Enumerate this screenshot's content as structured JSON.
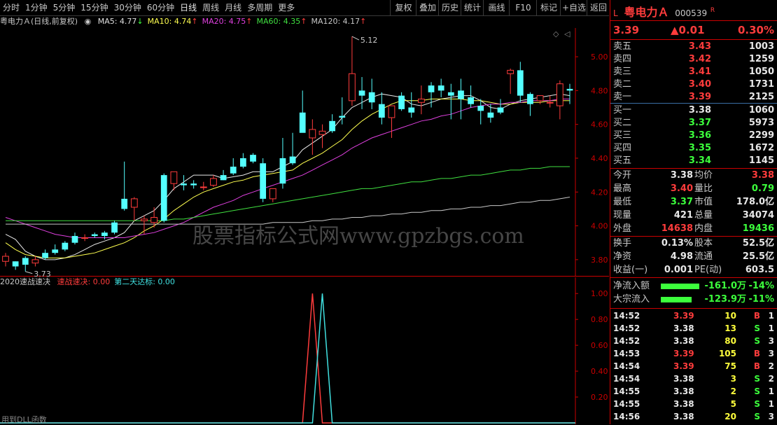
{
  "toolbar": {
    "left": [
      "分时",
      "1分钟",
      "5分钟",
      "15分钟",
      "30分钟",
      "60分钟",
      "日线",
      "周线",
      "月线",
      "多周期",
      "更多"
    ],
    "right": [
      "复权",
      "叠加",
      "历史",
      "统计",
      "画线",
      "F10",
      "标记",
      "+自选",
      "返回"
    ]
  },
  "ma_bar": {
    "title": "粤电力Ａ(日线,前复权)",
    "items": [
      {
        "label": "MA5: 4.77",
        "arrow": "↓",
        "color": "#e0e0e0"
      },
      {
        "label": "MA10: 4.74",
        "arrow": "↑",
        "color": "#ffff50"
      },
      {
        "label": "MA20: 4.75",
        "arrow": "↑",
        "color": "#e040e0"
      },
      {
        "label": "MA60: 4.35",
        "arrow": "↑",
        "color": "#40e040"
      },
      {
        "label": "MA120: 4.17",
        "arrow": "↑",
        "color": "#c8c8c8"
      }
    ]
  },
  "indicator_bar": {
    "name": "2020速战速决",
    "items": [
      {
        "label": "速战速决: 0.00",
        "color": "#ff3c3c"
      },
      {
        "label": "第二天达标: 0.00",
        "color": "#40e0e0"
      }
    ]
  },
  "watermark": "股票指标公式网www.gpzbgs.com",
  "footer_text": "用到DLL函数",
  "chart_data": [
    {
      "type": "candlestick",
      "ylim": [
        3.7,
        5.17
      ],
      "yticks": [
        "5.00",
        "4.80",
        "4.60",
        "4.40",
        "4.20",
        "4.00",
        "3.80"
      ],
      "annotations": [
        {
          "text": "5.12",
          "index": 35
        },
        {
          "text": "3.73",
          "index": 2
        }
      ],
      "candles": [
        [
          3.79,
          3.84,
          3.76,
          3.82
        ],
        [
          3.79,
          3.79,
          3.74,
          3.76
        ],
        [
          3.81,
          3.82,
          3.73,
          3.77
        ],
        [
          3.78,
          3.82,
          3.76,
          3.8
        ],
        [
          3.84,
          3.86,
          3.8,
          3.81
        ],
        [
          3.86,
          3.89,
          3.83,
          3.84
        ],
        [
          3.9,
          3.91,
          3.85,
          3.86
        ],
        [
          3.94,
          3.96,
          3.89,
          3.9
        ],
        [
          3.93,
          3.95,
          3.91,
          3.93
        ],
        [
          3.95,
          3.96,
          3.93,
          3.94
        ],
        [
          3.96,
          3.97,
          3.92,
          3.94
        ],
        [
          4.02,
          4.03,
          3.95,
          3.96
        ],
        [
          4.16,
          4.38,
          4.09,
          4.1
        ],
        [
          4.11,
          4.17,
          4.03,
          4.16
        ],
        [
          4.03,
          4.06,
          3.95,
          4.04
        ],
        [
          4.02,
          4.11,
          3.99,
          4.05
        ],
        [
          4.3,
          4.31,
          4.02,
          4.03
        ],
        [
          4.25,
          4.32,
          4.21,
          4.32
        ],
        [
          4.25,
          4.3,
          4.21,
          4.24
        ],
        [
          4.25,
          4.27,
          4.22,
          4.24
        ],
        [
          4.23,
          4.26,
          4.21,
          4.23
        ],
        [
          4.24,
          4.3,
          4.23,
          4.28
        ],
        [
          4.3,
          4.33,
          4.27,
          4.27
        ],
        [
          4.35,
          4.4,
          4.3,
          4.31
        ],
        [
          4.4,
          4.43,
          4.34,
          4.35
        ],
        [
          4.42,
          4.43,
          4.37,
          4.38
        ],
        [
          4.37,
          4.4,
          4.14,
          4.16
        ],
        [
          4.16,
          4.21,
          4.14,
          4.22
        ],
        [
          4.4,
          4.52,
          4.22,
          4.25
        ],
        [
          4.41,
          4.55,
          4.36,
          4.37
        ],
        [
          4.67,
          4.8,
          4.57,
          4.55
        ],
        [
          4.52,
          4.63,
          4.42,
          4.57
        ],
        [
          4.54,
          4.6,
          4.46,
          4.56
        ],
        [
          4.62,
          4.66,
          4.55,
          4.56
        ],
        [
          4.65,
          4.76,
          4.6,
          4.64
        ],
        [
          4.74,
          5.12,
          4.71,
          4.9
        ],
        [
          4.8,
          4.88,
          4.69,
          4.77
        ],
        [
          4.79,
          4.87,
          4.69,
          4.73
        ],
        [
          4.72,
          4.79,
          4.6,
          4.64
        ],
        [
          4.64,
          4.7,
          4.52,
          4.71
        ],
        [
          4.77,
          4.79,
          4.68,
          4.69
        ],
        [
          4.7,
          4.79,
          4.64,
          4.67
        ],
        [
          4.73,
          4.83,
          4.66,
          4.75
        ],
        [
          4.83,
          4.85,
          4.7,
          4.79
        ],
        [
          4.83,
          4.87,
          4.76,
          4.8
        ],
        [
          4.79,
          4.84,
          4.63,
          4.77
        ],
        [
          4.8,
          4.87,
          4.63,
          4.75
        ],
        [
          4.76,
          4.83,
          4.7,
          4.72
        ],
        [
          4.71,
          4.75,
          4.6,
          4.68
        ],
        [
          4.67,
          4.72,
          4.61,
          4.64
        ],
        [
          4.7,
          4.75,
          4.66,
          4.67
        ],
        [
          4.9,
          4.93,
          4.78,
          4.92
        ],
        [
          4.92,
          4.97,
          4.73,
          4.77
        ],
        [
          4.78,
          4.79,
          4.65,
          4.72
        ],
        [
          4.74,
          4.77,
          4.72,
          4.77
        ],
        [
          4.73,
          4.77,
          4.7,
          4.73
        ],
        [
          4.71,
          4.86,
          4.63,
          4.84
        ],
        [
          4.81,
          4.84,
          4.72,
          4.8
        ]
      ],
      "series": [
        {
          "name": "MA5",
          "color": "#e8e8e8"
        },
        {
          "name": "MA10",
          "color": "#ffff50"
        },
        {
          "name": "MA20",
          "color": "#e040e0"
        },
        {
          "name": "MA60",
          "color": "#40e040"
        },
        {
          "name": "MA120",
          "color": "#c8c8c8"
        }
      ],
      "ma_values": {
        "MA5": [
          3.95,
          3.92,
          3.85,
          3.82,
          3.8,
          3.8,
          3.81,
          3.83,
          3.86,
          3.89,
          3.91,
          3.93,
          3.96,
          4.03,
          4.06,
          4.09,
          4.15,
          4.22,
          4.26,
          4.3,
          4.3,
          4.3,
          4.28,
          4.29,
          4.3,
          4.32,
          4.32,
          4.32,
          4.35,
          4.38,
          4.45,
          4.49,
          4.53,
          4.57,
          4.64,
          4.7,
          4.73,
          4.76,
          4.78,
          4.77,
          4.76,
          4.72,
          4.71,
          4.73,
          4.75,
          4.76,
          4.77,
          4.77,
          4.74,
          4.7,
          4.69,
          4.72,
          4.74,
          4.75,
          4.76,
          4.77,
          4.78,
          4.77
        ],
        "MA10": [
          3.9,
          3.86,
          3.83,
          3.82,
          3.81,
          3.81,
          3.81,
          3.82,
          3.83,
          3.84,
          3.86,
          3.88,
          3.9,
          3.93,
          3.97,
          4.0,
          4.04,
          4.09,
          4.13,
          4.17,
          4.2,
          4.22,
          4.24,
          4.26,
          4.27,
          4.29,
          4.3,
          4.31,
          4.32,
          4.33,
          4.37,
          4.4,
          4.43,
          4.47,
          4.51,
          4.57,
          4.62,
          4.66,
          4.69,
          4.72,
          4.74,
          4.74,
          4.74,
          4.75,
          4.75,
          4.75,
          4.75,
          4.74,
          4.74,
          4.73,
          4.72,
          4.72,
          4.73,
          4.73,
          4.73,
          4.74,
          4.74,
          4.74
        ],
        "MA20": [
          4.05,
          4.03,
          4.01,
          3.99,
          3.97,
          3.95,
          3.94,
          3.93,
          3.93,
          3.93,
          3.93,
          3.93,
          3.93,
          3.94,
          3.95,
          3.96,
          3.98,
          4.0,
          4.02,
          4.05,
          4.08,
          4.11,
          4.13,
          4.15,
          4.18,
          4.2,
          4.22,
          4.24,
          4.26,
          4.28,
          4.3,
          4.33,
          4.36,
          4.39,
          4.42,
          4.46,
          4.49,
          4.52,
          4.54,
          4.56,
          4.58,
          4.6,
          4.62,
          4.63,
          4.65,
          4.66,
          4.68,
          4.7,
          4.71,
          4.72,
          4.72,
          4.73,
          4.73,
          4.74,
          4.74,
          4.74,
          4.75,
          4.75
        ],
        "MA60": [
          4.03,
          4.03,
          4.03,
          4.03,
          4.03,
          4.03,
          4.03,
          4.03,
          4.03,
          4.03,
          4.03,
          4.03,
          4.03,
          4.03,
          4.03,
          4.03,
          4.03,
          4.04,
          4.04,
          4.05,
          4.06,
          4.07,
          4.08,
          4.09,
          4.1,
          4.11,
          4.12,
          4.13,
          4.14,
          4.15,
          4.16,
          4.17,
          4.18,
          4.19,
          4.2,
          4.21,
          4.22,
          4.22,
          4.23,
          4.24,
          4.25,
          4.26,
          4.26,
          4.27,
          4.28,
          4.28,
          4.29,
          4.3,
          4.3,
          4.31,
          4.32,
          4.33,
          4.33,
          4.34,
          4.34,
          4.35,
          4.35,
          4.35
        ],
        "MA120": [
          4.01,
          4.01,
          4.01,
          4.01,
          4.01,
          4.01,
          4.01,
          4.01,
          4.01,
          4.01,
          4.01,
          4.01,
          4.01,
          4.01,
          4.01,
          4.01,
          4.01,
          4.01,
          4.01,
          4.01,
          4.01,
          4.01,
          4.01,
          4.01,
          4.01,
          4.01,
          4.01,
          4.02,
          4.02,
          4.02,
          4.02,
          4.03,
          4.03,
          4.04,
          4.04,
          4.05,
          4.05,
          4.06,
          4.06,
          4.07,
          4.07,
          4.08,
          4.08,
          4.09,
          4.09,
          4.1,
          4.1,
          4.11,
          4.11,
          4.12,
          4.12,
          4.13,
          4.14,
          4.14,
          4.15,
          4.15,
          4.16,
          4.17
        ]
      }
    },
    {
      "type": "line",
      "name": "2020速战速决",
      "ylim": [
        0,
        1.05
      ],
      "yticks": [
        "1.00",
        "0.80",
        "0.60",
        "0.40",
        "0.20"
      ],
      "series": [
        {
          "name": "速战速决",
          "color": "#ff3c3c",
          "spike_index": 31
        },
        {
          "name": "第二天达标",
          "color": "#40e0e0",
          "spike_index": 32
        }
      ]
    }
  ],
  "quote": {
    "market": "L",
    "name": "粤电力Ａ",
    "code": "000539",
    "flag": "R",
    "price": "3.39",
    "change": "▲0.01",
    "pct": "0.30%",
    "asks": [
      {
        "label": "卖五",
        "price": "3.43",
        "vol": "1003"
      },
      {
        "label": "卖四",
        "price": "3.42",
        "vol": "1259"
      },
      {
        "label": "卖三",
        "price": "3.41",
        "vol": "1050"
      },
      {
        "label": "卖二",
        "price": "3.40",
        "vol": "1731"
      },
      {
        "label": "卖一",
        "price": "3.39",
        "vol": "2125"
      }
    ],
    "bids": [
      {
        "label": "买一",
        "price": "3.38",
        "vol": "1060",
        "color": "wht"
      },
      {
        "label": "买二",
        "price": "3.37",
        "vol": "5973",
        "color": "grn"
      },
      {
        "label": "买三",
        "price": "3.36",
        "vol": "2299",
        "color": "grn"
      },
      {
        "label": "买四",
        "price": "3.35",
        "vol": "1672",
        "color": "grn"
      },
      {
        "label": "买五",
        "price": "3.34",
        "vol": "1145",
        "color": "grn"
      }
    ],
    "stats": [
      {
        "l1": "今开",
        "v1": "3.38",
        "c1": "wht",
        "l2": "均价",
        "v2": "3.38",
        "c2": "red"
      },
      {
        "l1": "最高",
        "v1": "3.40",
        "c1": "red",
        "l2": "量比",
        "v2": "0.79",
        "c2": "grn"
      },
      {
        "l1": "最低",
        "v1": "3.37",
        "c1": "grn",
        "l2": "市值",
        "v2": "178.0亿",
        "c2": "wht"
      },
      {
        "l1": "现量",
        "v1": "421",
        "c1": "wht",
        "l2": "总量",
        "v2": "34074",
        "c2": "wht"
      },
      {
        "l1": "外盘",
        "v1": "14638",
        "c1": "red",
        "l2": "内盘",
        "v2": "19436",
        "c2": "grn"
      }
    ],
    "fin": [
      {
        "l1": "换手",
        "v1": "0.13%",
        "c1": "wht",
        "l2": "股本",
        "v2": "52.5亿",
        "c2": "wht"
      },
      {
        "l1": "净资",
        "v1": "4.98",
        "c1": "wht",
        "l2": "流通",
        "v2": "25.5亿",
        "c2": "wht"
      },
      {
        "l1": "收益(一)",
        "v1": "0.001",
        "c1": "wht",
        "l2": "PE(动)",
        "v2": "603.5",
        "c2": "wht"
      }
    ],
    "flows": [
      {
        "label": "净流入额",
        "value": "-161.0万",
        "pct": "-14%",
        "bar": 1.0
      },
      {
        "label": "大宗流入",
        "value": "-123.9万",
        "pct": "-11%",
        "bar": 0.8
      }
    ],
    "ticks": [
      {
        "t": "14:52",
        "p": "3.39",
        "pc": "red",
        "v": "10",
        "bs": "B",
        "n": "1"
      },
      {
        "t": "14:52",
        "p": "3.38",
        "pc": "wht",
        "v": "13",
        "bs": "S",
        "n": "1"
      },
      {
        "t": "14:52",
        "p": "3.38",
        "pc": "wht",
        "v": "80",
        "bs": "S",
        "n": "3"
      },
      {
        "t": "14:53",
        "p": "3.39",
        "pc": "red",
        "v": "105",
        "bs": "B",
        "n": "3"
      },
      {
        "t": "14:54",
        "p": "3.39",
        "pc": "red",
        "v": "75",
        "bs": "B",
        "n": "2"
      },
      {
        "t": "14:54",
        "p": "3.38",
        "pc": "wht",
        "v": "3",
        "bs": "S",
        "n": "2"
      },
      {
        "t": "14:55",
        "p": "3.38",
        "pc": "wht",
        "v": "2",
        "bs": "S",
        "n": "1"
      },
      {
        "t": "14:55",
        "p": "3.38",
        "pc": "wht",
        "v": "5",
        "bs": "S",
        "n": "1"
      },
      {
        "t": "14:56",
        "p": "3.38",
        "pc": "wht",
        "v": "20",
        "bs": "S",
        "n": "3"
      }
    ]
  }
}
